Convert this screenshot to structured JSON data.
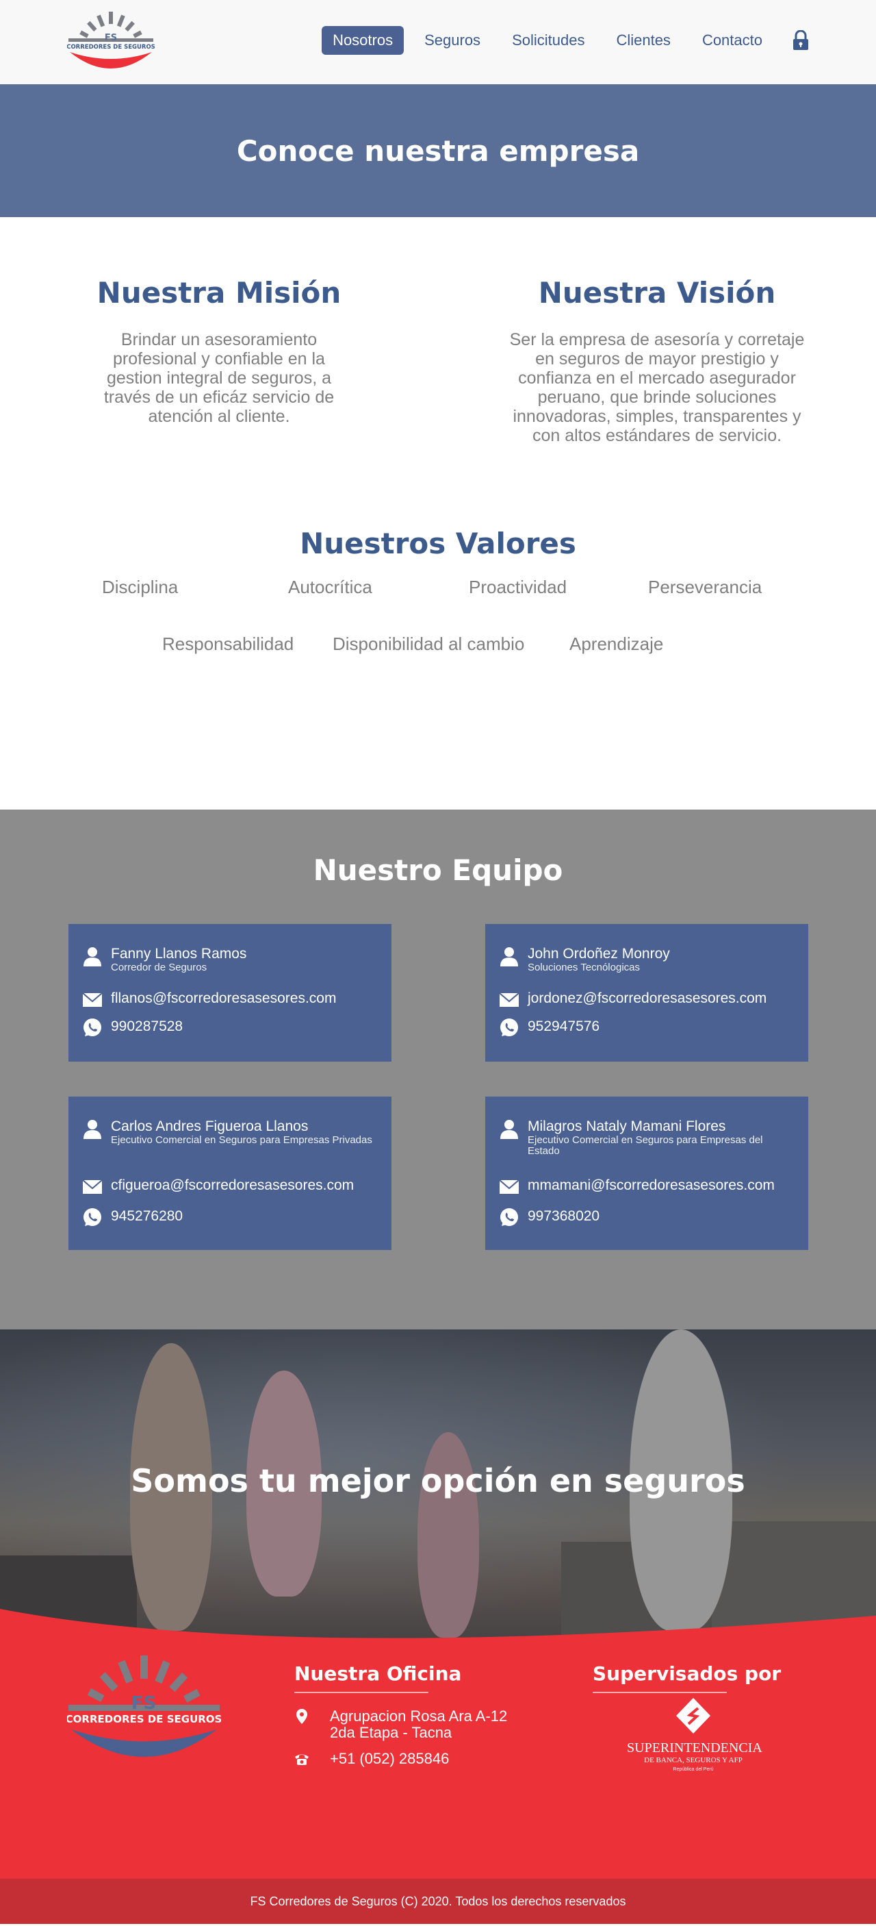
{
  "header": {
    "nav": [
      {
        "label": "Nosotros",
        "active": true
      },
      {
        "label": "Seguros"
      },
      {
        "label": "Solicitudes"
      },
      {
        "label": "Clientes"
      },
      {
        "label": "Contacto"
      }
    ],
    "logo_text": "FS",
    "logo_subtext": "CORREDORES DE SEGUROS",
    "lock_icon": "lock-icon"
  },
  "banner": {
    "title": "Conoce nuestra empresa"
  },
  "mission": {
    "title": "Nuestra Misión",
    "text": "Brindar un asesoramiento profesional y confiable en la gestion integral de seguros, a través de un eficáz servicio de atención al cliente."
  },
  "vision": {
    "title": "Nuestra Visión",
    "text": "Ser la empresa de asesoría y corretaje en seguros de mayor prestigio y confianza en el mercado asegurador peruano, que brinde soluciones innovadoras, simples, transparentes y con altos estándares de servicio."
  },
  "values": {
    "title": "Nuestros Valores",
    "items": [
      "Disciplina",
      "Autocrítica",
      "Proactividad",
      "Perseverancia",
      "Responsabilidad",
      "Disponibilidad al cambio",
      "Aprendizaje"
    ]
  },
  "team": {
    "title": "Nuestro Equipo",
    "members": [
      {
        "name": "Fanny Llanos Ramos",
        "role": "Corredor de Seguros",
        "email": "fllanos@fscorredoresasesores.com",
        "phone": "990287528"
      },
      {
        "name": "John Ordoñez Monroy",
        "role": "Soluciones Tecnólogicas",
        "email": "jordonez@fscorredoresasesores.com",
        "phone": "952947576"
      },
      {
        "name": "Carlos Andres Figueroa Llanos",
        "role": "Ejecutivo Comercial en Seguros para Empresas Privadas",
        "email": "cfigueroa@fscorredoresasesores.com",
        "phone": "945276280"
      },
      {
        "name": "Milagros Nataly Mamani Flores",
        "role": "Ejecutivo Comercial en Seguros para Empresas del Estado",
        "email": "mmamani@fscorredoresasesores.com",
        "phone": "997368020"
      }
    ]
  },
  "hero": {
    "title": "Somos tu mejor opción en seguros"
  },
  "footer": {
    "office_title": "Nuestra Oficina",
    "address_line1": "Agrupacion Rosa Ara A-12",
    "address_line2": "2da Etapa - Tacna",
    "phone": "+51 (052) 285846",
    "supervised_title": "Supervisados por",
    "sbs_name": "SUPERINTENDENCIA",
    "sbs_sub": "DE BANCA, SEGUROS Y AFP",
    "sbs_tiny": "República del Perú",
    "copyright": "FS Corredores de Seguros (C) 2020. Todos los derechos reservados"
  },
  "colors": {
    "brand_blue": "#4a6191",
    "banner_blue": "#5a6f98",
    "heading_blue": "#3d5a8c",
    "team_bg": "#8c8c8c",
    "footer_red": "#ec3238",
    "copyright_red": "#c42e35"
  }
}
